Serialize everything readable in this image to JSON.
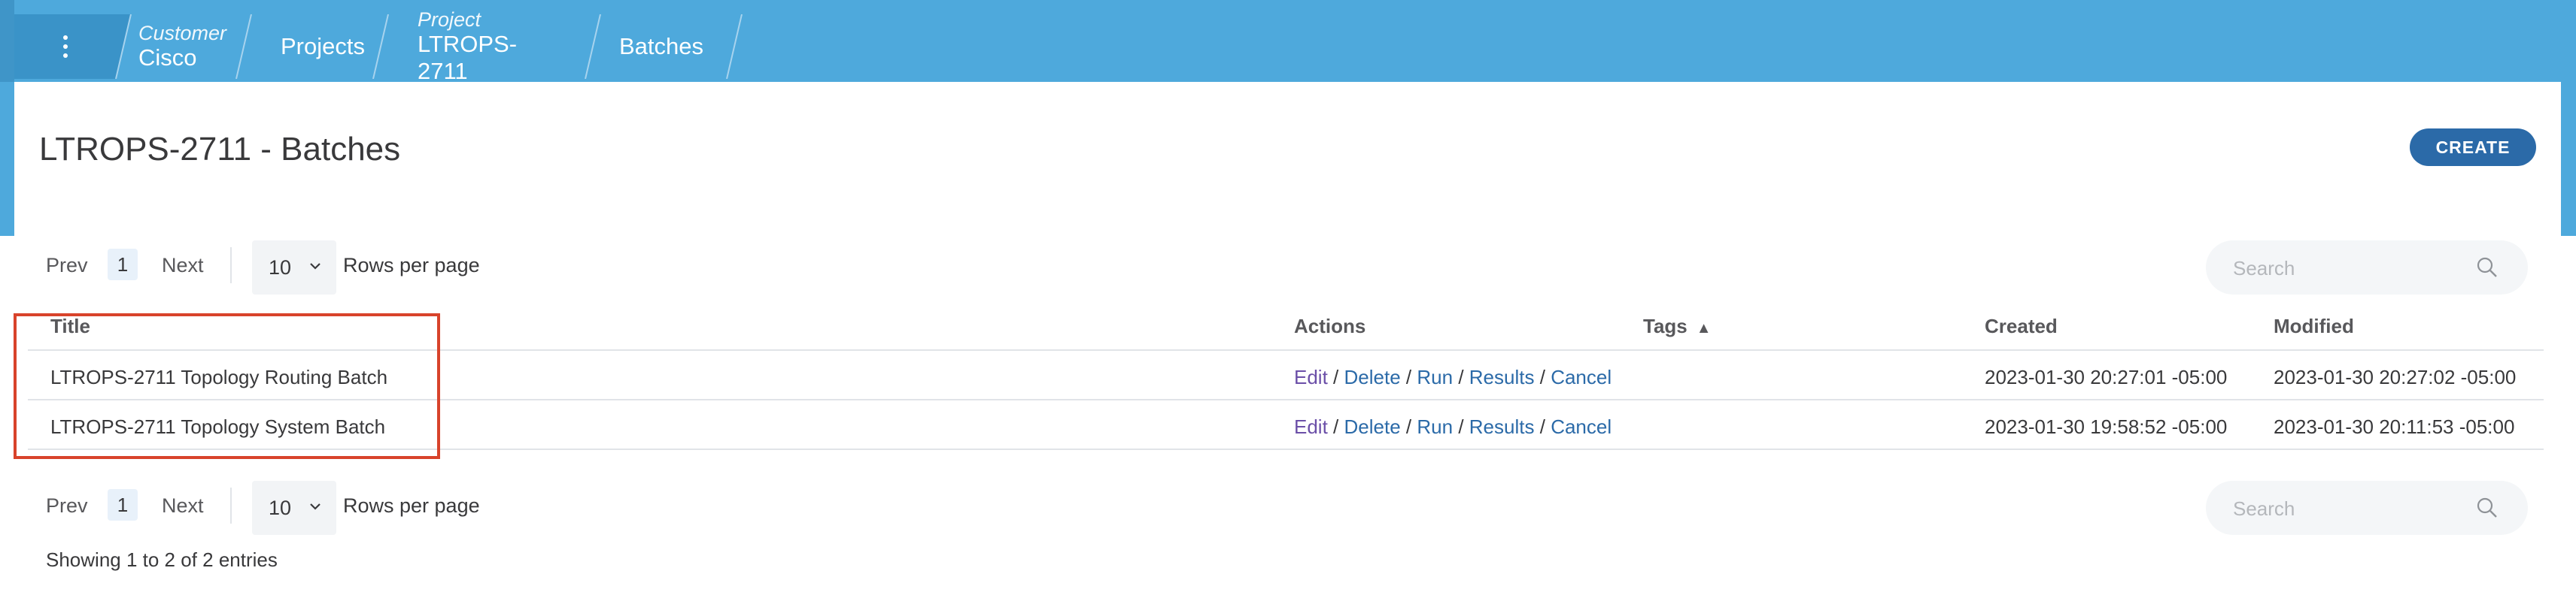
{
  "breadcrumb": {
    "items": [
      {
        "sup": "Customer",
        "label": "Cisco"
      },
      {
        "sup": "",
        "label": "Projects"
      },
      {
        "sup": "Project",
        "label": "LTROPS-2711"
      },
      {
        "sup": "",
        "label": "Batches"
      }
    ]
  },
  "page": {
    "title": "LTROPS-2711 - Batches",
    "create_label": "CREATE"
  },
  "pager": {
    "prev_label": "Prev",
    "page_number": "1",
    "next_label": "Next",
    "rows_value": "10",
    "rows_label": "Rows per page",
    "search_placeholder": "Search"
  },
  "table": {
    "columns": [
      "Title",
      "Actions",
      "Tags",
      "Created",
      "Modified"
    ],
    "rows": [
      {
        "title": "LTROPS-2711 Topology Routing Batch",
        "actions": [
          "Edit",
          "Delete",
          "Run",
          "Results",
          "Cancel"
        ],
        "tags": "",
        "created": "2023-01-30 20:27:01 -05:00",
        "modified": "2023-01-30 20:27:02 -05:00"
      },
      {
        "title": "LTROPS-2711 Topology System Batch",
        "actions": [
          "Edit",
          "Delete",
          "Run",
          "Results",
          "Cancel"
        ],
        "tags": "",
        "created": "2023-01-30 19:58:52 -05:00",
        "modified": "2023-01-30 20:11:53 -05:00"
      }
    ],
    "sort_indicator": "▲"
  },
  "footer": {
    "showing": "Showing 1 to 2 of 2 entries"
  },
  "colors": {
    "topbar": "#4ea9dc",
    "accent": "#2b6aa8",
    "highlight": "#d8432b"
  }
}
